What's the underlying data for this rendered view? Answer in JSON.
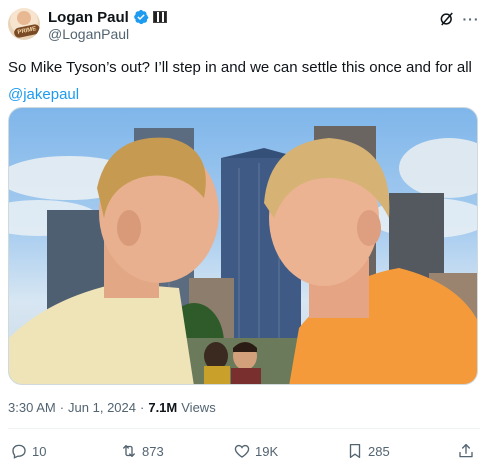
{
  "author": {
    "display_name": "Logan Paul",
    "handle": "@LoganPaul",
    "avatar_text": "PRIME",
    "verified": true
  },
  "tweet": {
    "text": "So Mike Tyson’s out? I’ll step in and we can settle this once and for all",
    "mention": "@jakepaul"
  },
  "meta": {
    "time": "3:30 AM",
    "separator": "·",
    "date": "Jun 1, 2024",
    "views_count": "7.1M",
    "views_label": "Views"
  },
  "actions": {
    "replies": "10",
    "reposts": "873",
    "likes": "19K",
    "bookmarks": "285"
  },
  "colors": {
    "accent": "#1d9bf0",
    "secondary_text": "#536471",
    "primary_text": "#0f1419"
  },
  "icons": [
    "verified-badge-icon",
    "flag-icon",
    "grok-icon",
    "more-icon",
    "reply-icon",
    "repost-icon",
    "like-icon",
    "bookmark-icon",
    "share-icon"
  ]
}
